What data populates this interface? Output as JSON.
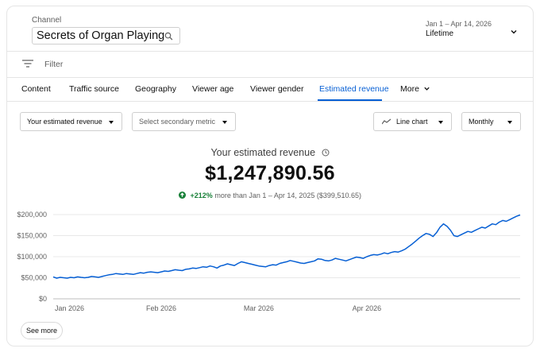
{
  "header": {
    "channel_label": "Channel",
    "channel_name": "Secrets of Organ Playing",
    "date_range": "Jan 1 – Apr 14, 2026",
    "date_label": "Lifetime"
  },
  "filter": {
    "label": "Filter"
  },
  "tabs": [
    {
      "label": "Content"
    },
    {
      "label": "Traffic source"
    },
    {
      "label": "Geography"
    },
    {
      "label": "Viewer age"
    },
    {
      "label": "Viewer gender"
    },
    {
      "label": "Estimated revenue",
      "active": true
    },
    {
      "label": "More"
    }
  ],
  "controls": {
    "metric_select": "Your estimated revenue",
    "secondary_select": "Select secondary metric",
    "chart_type_select": "Line chart",
    "interval_select": "Monthly"
  },
  "metric": {
    "title": "Your estimated revenue",
    "value": "$1,247,890.56",
    "change": "+212%",
    "compare_text": "more than Jan 1 – Apr 14, 2025 ($399,510.65)"
  },
  "chart_data": {
    "type": "line",
    "xlabel": "",
    "ylabel": "",
    "ylim": [
      0,
      200000
    ],
    "y_ticks": [
      "$200,000",
      "$150,000",
      "$100,000",
      "$50,000",
      "$0"
    ],
    "x_ticks": [
      "Jan 2026",
      "Feb 2026",
      "Mar 2026",
      "Apr 2026"
    ],
    "x_tick_days": [
      0,
      31,
      59,
      90
    ],
    "line_color": "#065fd4",
    "series": [
      {
        "values": [
          52000,
          49000,
          51000,
          50000,
          49000,
          51000,
          50000,
          52000,
          51000,
          50000,
          51000,
          53000,
          52000,
          51000,
          53000,
          55000,
          57000,
          58000,
          60000,
          59000,
          58000,
          60000,
          59000,
          58000,
          60000,
          62000,
          61000,
          63000,
          64000,
          63000,
          62000,
          64000,
          66000,
          65000,
          67000,
          69000,
          68000,
          67000,
          70000,
          71000,
          73000,
          72000,
          74000,
          76000,
          75000,
          78000,
          76000,
          73000,
          78000,
          80000,
          83000,
          81000,
          79000,
          84000,
          88000,
          86000,
          84000,
          82000,
          80000,
          78000,
          77000,
          76000,
          79000,
          81000,
          80000,
          84000,
          86000,
          88000,
          91000,
          89000,
          87000,
          85000,
          84000,
          86000,
          88000,
          90000,
          95000,
          94000,
          91000,
          90000,
          92000,
          96000,
          94000,
          92000,
          90000,
          93000,
          96000,
          99000,
          98000,
          96000,
          100000,
          103000,
          105000,
          104000,
          106000,
          109000,
          107000,
          110000,
          112000,
          111000,
          114000,
          118000,
          124000,
          130000,
          137000,
          144000,
          150000,
          155000,
          153000,
          148000,
          157000,
          170000,
          178000,
          172000,
          163000,
          150000,
          148000,
          152000,
          156000,
          160000,
          158000,
          162000,
          166000,
          170000,
          168000,
          173000,
          178000,
          176000,
          182000,
          186000,
          184000,
          188000,
          192000,
          196000,
          199000
        ]
      }
    ]
  },
  "footer": {
    "see_more_label": "See more"
  }
}
